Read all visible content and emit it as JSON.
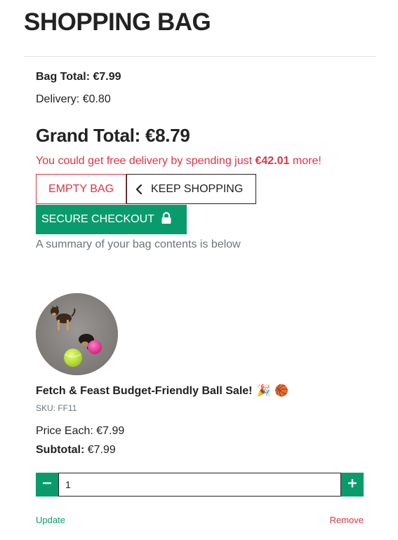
{
  "header": {
    "title": "SHOPPING BAG"
  },
  "totals": {
    "bag_total_label": "Bag Total:",
    "bag_total_value": "€7.99",
    "delivery_label": "Delivery:",
    "delivery_value": "€0.80",
    "grand_total_label": "Grand Total:",
    "grand_total_value": "€8.79"
  },
  "free_delivery": {
    "prefix": "You could get free delivery by spending just ",
    "amount": "€42.01",
    "suffix": " more!"
  },
  "actions": {
    "empty_bag_label": "EMPTY BAG",
    "keep_shopping_label": "KEEP SHOPPING",
    "checkout_label": "SECURE CHECKOUT"
  },
  "summary_note": "A summary of your bag contents is below",
  "item": {
    "name": "Fetch & Feast Budget-Friendly Ball Sale!",
    "emoji_party": "🎉",
    "emoji_ball": "🏀",
    "sku": "SKU: FF11",
    "price_each_label": "Price Each:",
    "price_each_value": "€7.99",
    "subtotal_label": "Subtotal:",
    "subtotal_value": "€7.99",
    "quantity": "1",
    "update_label": "Update",
    "remove_label": "Remove"
  },
  "icons": {
    "keep_shopping": "chevron-left-icon",
    "checkout": "lock-icon",
    "decrement": "minus-icon",
    "increment": "plus-icon"
  },
  "colors": {
    "accent_green": "#0a9b6d",
    "danger_red": "#dc3545",
    "muted_gray": "#6c757d",
    "text_dark": "#222222"
  }
}
